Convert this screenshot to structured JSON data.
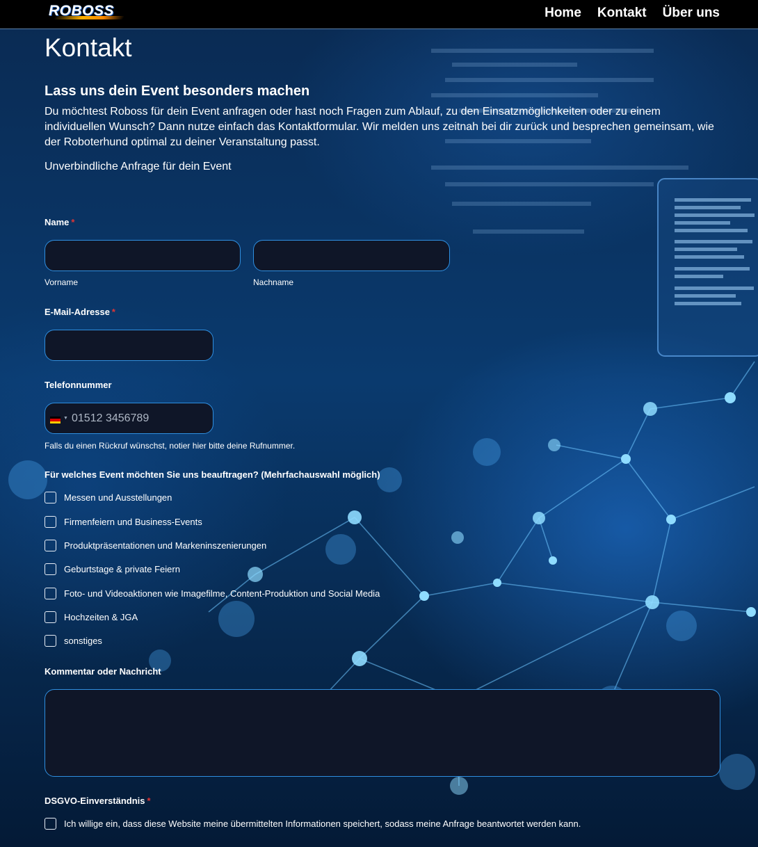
{
  "nav": {
    "logo_text": "ROBOSS",
    "links": [
      "Home",
      "Kontakt",
      "Über uns"
    ]
  },
  "page": {
    "title": "Kontakt",
    "heading": "Lass uns dein Event besonders machen",
    "intro": "Du möchtest Roboss für dein Event anfragen oder hast noch Fragen zum Ablauf, zu den Einsatzmöglichkeiten oder zu einem individuellen Wunsch? Dann nutze einfach das Kontaktformular. Wir melden uns zeitnah bei dir zurück und besprechen gemeinsam, wie der Roboterhund optimal zu deiner Veranstaltung passt.",
    "subheading": "Unverbindliche Anfrage für dein Event"
  },
  "form": {
    "name_label": "Name",
    "required_mark": "*",
    "first_name_sublabel": "Vorname",
    "last_name_sublabel": "Nachname",
    "first_name_value": "",
    "last_name_value": "",
    "email_label": "E-Mail-Adresse",
    "email_value": "",
    "phone_label": "Telefonnummer",
    "phone_placeholder": "01512 3456789",
    "phone_country_icon": "germany-flag-icon",
    "phone_hint": "Falls du einen Rückruf wünschst, notier hier bitte deine Rufnummer.",
    "events_label": "Für welches Event möchten Sie uns beauftragen? (Mehrfachauswahl möglich)",
    "events": [
      "Messen und Ausstellungen",
      "Firmenfeiern und Business-Events",
      "Produktpräsentationen und Markeninszenierungen",
      "Geburtstage & private Feiern",
      "Foto- und Videoaktionen wie Imagefilme, Content-Produktion und Social Media",
      "Hochzeiten & JGA",
      "sonstiges"
    ],
    "comment_label": "Kommentar oder Nachricht",
    "comment_value": "",
    "gdpr_label": "DSGVO-Einverständnis",
    "gdpr_text": "Ich willige ein, dass diese Website meine übermittelten Informationen speichert, sodass meine Anfrage beantwortet werden kann."
  },
  "colors": {
    "field_border": "#2f8fe0",
    "field_bg": "#0f1628",
    "required": "#e03535",
    "navbar": "#000000"
  }
}
